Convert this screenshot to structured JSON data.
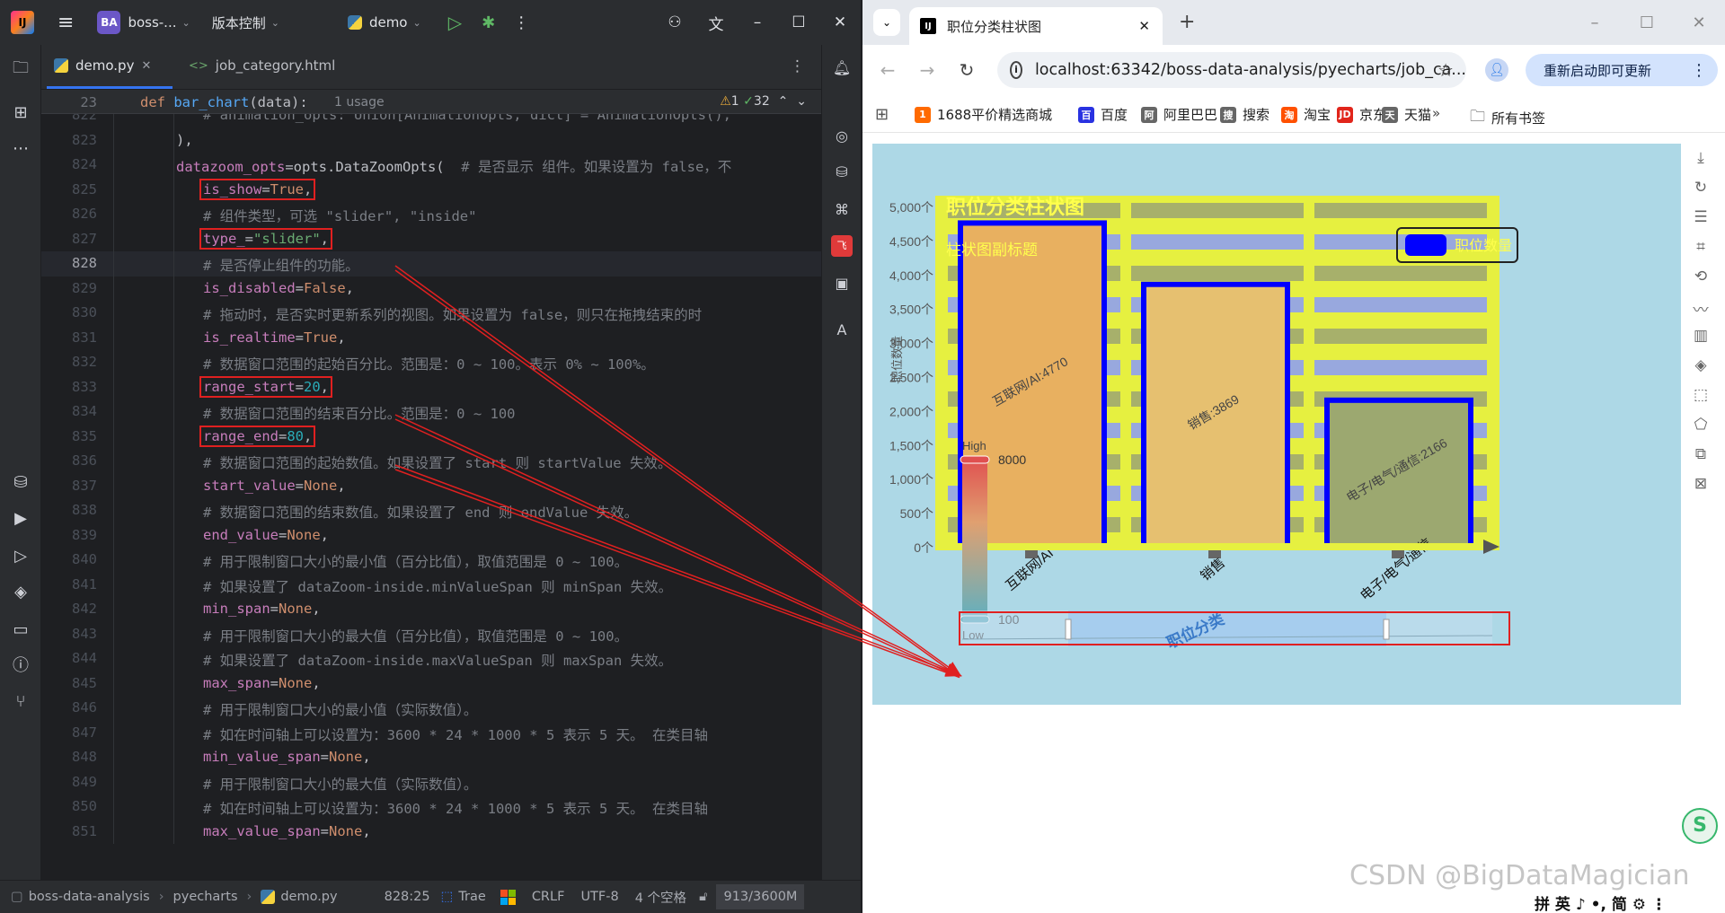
{
  "ide": {
    "logo": "IJ",
    "project_badge": "BA",
    "project_name": "boss-...",
    "vcs_menu": "版本控制",
    "run_config": "demo",
    "tabs": [
      {
        "label": "demo.py",
        "active": true
      },
      {
        "label": "job_category.html",
        "active": false
      }
    ],
    "sticky": {
      "line": "23",
      "code_def": "def",
      "code_fn": "bar_chart",
      "code_rest": "(data):",
      "usage": "1 usage",
      "warnings": "1",
      "checks": "32"
    },
    "code_lines": [
      {
        "n": "822",
        "segs": [
          [
            "com",
            "# animation_opts: Union[AnimationOpts, dict] = AnimationOpts(),"
          ]
        ],
        "indent": 2
      },
      {
        "n": "823",
        "segs": [
          [
            "plain",
            "),"
          ]
        ],
        "indent": 1
      },
      {
        "n": "824",
        "segs": [
          [
            "kwarg2",
            "datazoom_opts"
          ],
          [
            "plain",
            "=opts.DataZoomOpts(  "
          ],
          [
            "com",
            "# 是否显示 组件。如果设置为 false，不"
          ]
        ],
        "indent": 1
      },
      {
        "n": "825",
        "segs": [
          [
            "kwarg2",
            "is_show"
          ],
          [
            "plain",
            "="
          ],
          [
            "kw",
            "True"
          ],
          [
            "plain",
            ","
          ]
        ],
        "indent": 2
      },
      {
        "n": "826",
        "segs": [
          [
            "com",
            "# 组件类型，可选 \"slider\", \"inside\""
          ]
        ],
        "indent": 2
      },
      {
        "n": "827",
        "segs": [
          [
            "kwarg2",
            "type_"
          ],
          [
            "plain",
            "="
          ],
          [
            "str",
            "\"slider\""
          ],
          [
            "plain",
            ","
          ]
        ],
        "indent": 2
      },
      {
        "n": "828",
        "segs": [
          [
            "com",
            "# 是否停止组件的功能。"
          ]
        ],
        "indent": 2,
        "current": true
      },
      {
        "n": "829",
        "segs": [
          [
            "kwarg2",
            "is_disabled"
          ],
          [
            "plain",
            "="
          ],
          [
            "kw",
            "False"
          ],
          [
            "plain",
            ","
          ]
        ],
        "indent": 2
      },
      {
        "n": "830",
        "segs": [
          [
            "com",
            "# 拖动时，是否实时更新系列的视图。如果设置为 false，则只在拖拽结束的时"
          ]
        ],
        "indent": 2
      },
      {
        "n": "831",
        "segs": [
          [
            "kwarg2",
            "is_realtime"
          ],
          [
            "plain",
            "="
          ],
          [
            "kw",
            "True"
          ],
          [
            "plain",
            ","
          ]
        ],
        "indent": 2
      },
      {
        "n": "832",
        "segs": [
          [
            "com",
            "# 数据窗口范围的起始百分比。范围是：0 ~ 100。表示 0% ~ 100%。"
          ]
        ],
        "indent": 2
      },
      {
        "n": "833",
        "segs": [
          [
            "kwarg2",
            "range_start"
          ],
          [
            "plain",
            "="
          ],
          [
            "num",
            "20"
          ],
          [
            "plain",
            ","
          ]
        ],
        "indent": 2
      },
      {
        "n": "834",
        "segs": [
          [
            "com",
            "# 数据窗口范围的结束百分比。范围是：0 ~ 100"
          ]
        ],
        "indent": 2
      },
      {
        "n": "835",
        "segs": [
          [
            "kwarg2",
            "range_end"
          ],
          [
            "plain",
            "="
          ],
          [
            "num",
            "80"
          ],
          [
            "plain",
            ","
          ]
        ],
        "indent": 2
      },
      {
        "n": "836",
        "segs": [
          [
            "com",
            "# 数据窗口范围的起始数值。如果设置了 start 则 startValue 失效。"
          ]
        ],
        "indent": 2
      },
      {
        "n": "837",
        "segs": [
          [
            "kwarg2",
            "start_value"
          ],
          [
            "plain",
            "="
          ],
          [
            "kw",
            "None"
          ],
          [
            "plain",
            ","
          ]
        ],
        "indent": 2
      },
      {
        "n": "838",
        "segs": [
          [
            "com",
            "# 数据窗口范围的结束数值。如果设置了 end 则 endValue 失效。"
          ]
        ],
        "indent": 2
      },
      {
        "n": "839",
        "segs": [
          [
            "kwarg2",
            "end_value"
          ],
          [
            "plain",
            "="
          ],
          [
            "kw",
            "None"
          ],
          [
            "plain",
            ","
          ]
        ],
        "indent": 2
      },
      {
        "n": "840",
        "segs": [
          [
            "com",
            "# 用于限制窗口大小的最小值（百分比值），取值范围是 0 ~ 100。"
          ]
        ],
        "indent": 2
      },
      {
        "n": "841",
        "segs": [
          [
            "com",
            "# 如果设置了 dataZoom-inside.minValueSpan 则 minSpan 失效。"
          ]
        ],
        "indent": 2
      },
      {
        "n": "842",
        "segs": [
          [
            "kwarg2",
            "min_span"
          ],
          [
            "plain",
            "="
          ],
          [
            "kw",
            "None"
          ],
          [
            "plain",
            ","
          ]
        ],
        "indent": 2
      },
      {
        "n": "843",
        "segs": [
          [
            "com",
            "# 用于限制窗口大小的最大值（百分比值），取值范围是 0 ~ 100。"
          ]
        ],
        "indent": 2
      },
      {
        "n": "844",
        "segs": [
          [
            "com",
            "# 如果设置了 dataZoom-inside.maxValueSpan 则 maxSpan 失效。"
          ]
        ],
        "indent": 2
      },
      {
        "n": "845",
        "segs": [
          [
            "kwarg2",
            "max_span"
          ],
          [
            "plain",
            "="
          ],
          [
            "kw",
            "None"
          ],
          [
            "plain",
            ","
          ]
        ],
        "indent": 2
      },
      {
        "n": "846",
        "segs": [
          [
            "com",
            "# 用于限制窗口大小的最小值（实际数值）。"
          ]
        ],
        "indent": 2
      },
      {
        "n": "847",
        "segs": [
          [
            "com",
            "# 如在时间轴上可以设置为：3600 * 24 * 1000 * 5 表示 5 天。 在类目轴"
          ]
        ],
        "indent": 2
      },
      {
        "n": "848",
        "segs": [
          [
            "kwarg2",
            "min_value_span"
          ],
          [
            "plain",
            "="
          ],
          [
            "kw",
            "None"
          ],
          [
            "plain",
            ","
          ]
        ],
        "indent": 2
      },
      {
        "n": "849",
        "segs": [
          [
            "com",
            "# 用于限制窗口大小的最大值（实际数值）。"
          ]
        ],
        "indent": 2
      },
      {
        "n": "850",
        "segs": [
          [
            "com",
            "# 如在时间轴上可以设置为：3600 * 24 * 1000 * 5 表示 5 天。 在类目轴"
          ]
        ],
        "indent": 2
      },
      {
        "n": "851",
        "segs": [
          [
            "kwarg2",
            "max_value_span"
          ],
          [
            "plain",
            "="
          ],
          [
            "kw",
            "None"
          ],
          [
            "plain",
            ","
          ]
        ],
        "indent": 2
      }
    ],
    "status": {
      "breadcrumb": [
        "boss-data-analysis",
        "pyecharts",
        "demo.py"
      ],
      "position": "828:25",
      "plugin": "Trae",
      "line_sep": "CRLF",
      "encoding": "UTF-8",
      "indent": "4 个空格",
      "memory": "913/3600M"
    }
  },
  "browser": {
    "tab_title": "职位分类柱状图",
    "url": "localhost:63342/boss-data-analysis/pyecharts/job_ca...",
    "update_label": "重新启动即可更新",
    "bookmarks": [
      {
        "label": "1688平价精选商城",
        "color": "#ff6a00",
        "glyph": "1"
      },
      {
        "label": "百度",
        "color": "#2932e1",
        "glyph": "百"
      },
      {
        "label": "阿里巴巴",
        "color": "#666666",
        "glyph": "阿"
      },
      {
        "label": "搜索",
        "color": "#666666",
        "glyph": "搜"
      },
      {
        "label": "淘宝",
        "color": "#ff5000",
        "glyph": "淘"
      },
      {
        "label": "京东",
        "color": "#e1251b",
        "glyph": "JD"
      },
      {
        "label": "天猫",
        "color": "#666666",
        "glyph": "天"
      }
    ],
    "all_bookmarks": "所有书签",
    "watermark": "CSDN @BigDataMagician",
    "ime": "拼 英 ♪ •, 简 ⚙ ⋮"
  },
  "chart_data": {
    "type": "bar",
    "title": "职位分类柱状图",
    "subtitle": "柱状图副标题",
    "legend": {
      "label": "职位数量",
      "position": "top-right"
    },
    "ylabel": "职位数量",
    "ylim": [
      0,
      5000
    ],
    "yticks": [
      "0个",
      "500个",
      "1,000个",
      "1,500个",
      "2,000个",
      "2,500个",
      "3,000个",
      "3,500个",
      "4,000个",
      "4,500个",
      "5,000个"
    ],
    "categories": [
      "互联网/AI",
      "销售",
      "电子/电气/通信"
    ],
    "values": [
      4770,
      3869,
      2166
    ],
    "bar_labels": [
      "互联网/AI:4770",
      "销售:3869",
      "电子/电气/通信:2166"
    ],
    "visual_map": {
      "high": "High",
      "low": "Low",
      "max": "8000",
      "min": "100"
    },
    "datazoom": {
      "range_start": 20,
      "range_end": 80,
      "label": "职位分类"
    },
    "colors": {
      "background": "#add8e6",
      "bar_border": "#0000ff",
      "axis": "#e6f040",
      "title": "#ffff4d"
    }
  }
}
